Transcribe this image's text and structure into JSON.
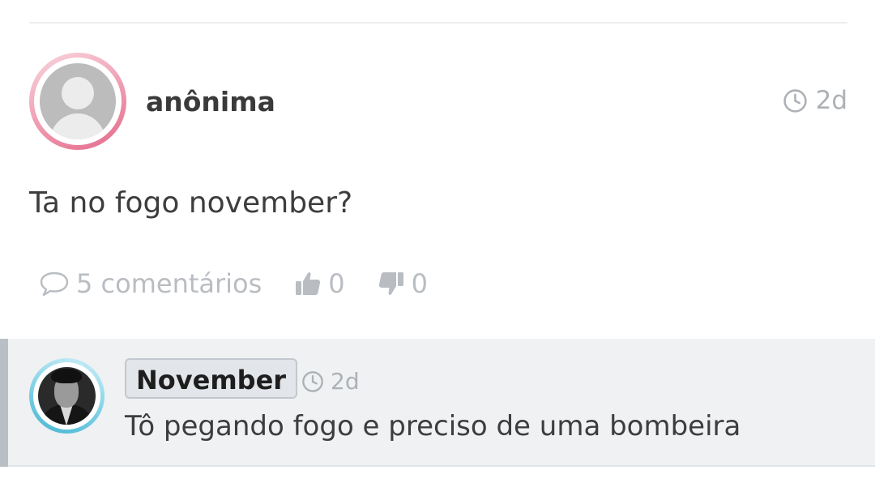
{
  "post": {
    "author": "anônima",
    "avatar_icon": "default-user-avatar",
    "time": "2d",
    "text": "Ta no fogo november?",
    "comments_label": "5 comentários",
    "likes": "0",
    "dislikes": "0"
  },
  "reply": {
    "author": "November",
    "avatar_icon": "user-photo-avatar",
    "time": "2d",
    "text": "Tô pegando fogo e preciso de uma bombeira"
  },
  "colors": {
    "author_ring": "#e4698a",
    "reply_ring": "#47b6d3",
    "muted": "#b9bdc2",
    "reply_background": "#eff1f3"
  }
}
